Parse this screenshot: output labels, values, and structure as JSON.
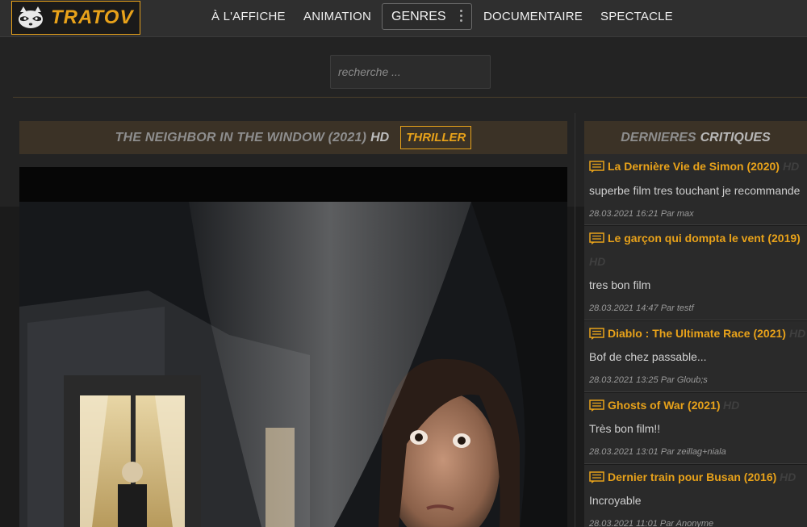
{
  "brand": {
    "name": "TRATOV"
  },
  "nav": {
    "items": [
      "À L'AFFICHE",
      "ANIMATION",
      "GENRES",
      "DOCUMENTAIRE",
      "SPECTACLE"
    ]
  },
  "search": {
    "placeholder": "recherche ..."
  },
  "movie": {
    "title": "THE NEIGHBOR IN THE WINDOW (2021)",
    "quality": "HD",
    "genre": "THRILLER"
  },
  "sidebar": {
    "header_word1": "DERNIERES",
    "header_word2": "CRITIQUES",
    "reviews": [
      {
        "title": "La Dernière Vie de Simon (2020)",
        "quality": "HD",
        "text": "superbe film tres touchant je recommande",
        "meta": "28.03.2021 16:21 Par max"
      },
      {
        "title": "Le garçon qui dompta le vent (2019)",
        "quality": "HD",
        "text": "tres bon film",
        "meta": "28.03.2021 14:47 Par testf"
      },
      {
        "title": "Diablo : The Ultimate Race (2021)",
        "quality": "HD",
        "text": "Bof de chez passable...",
        "meta": "28.03.2021 13:25 Par Gloub;s"
      },
      {
        "title": "Ghosts of War (2021)",
        "quality": "HD",
        "text": "Très bon film!!",
        "meta": "28.03.2021 13:01 Par zeillag+niala"
      },
      {
        "title": "Dernier train pour Busan (2016)",
        "quality": "HD",
        "text": "Incroyable",
        "meta": "28.03.2021 11:01 Par Anonyme"
      }
    ]
  },
  "colors": {
    "accent": "#e8a21a",
    "background": "#1b1b1b",
    "header_bar": "#3b3226"
  }
}
